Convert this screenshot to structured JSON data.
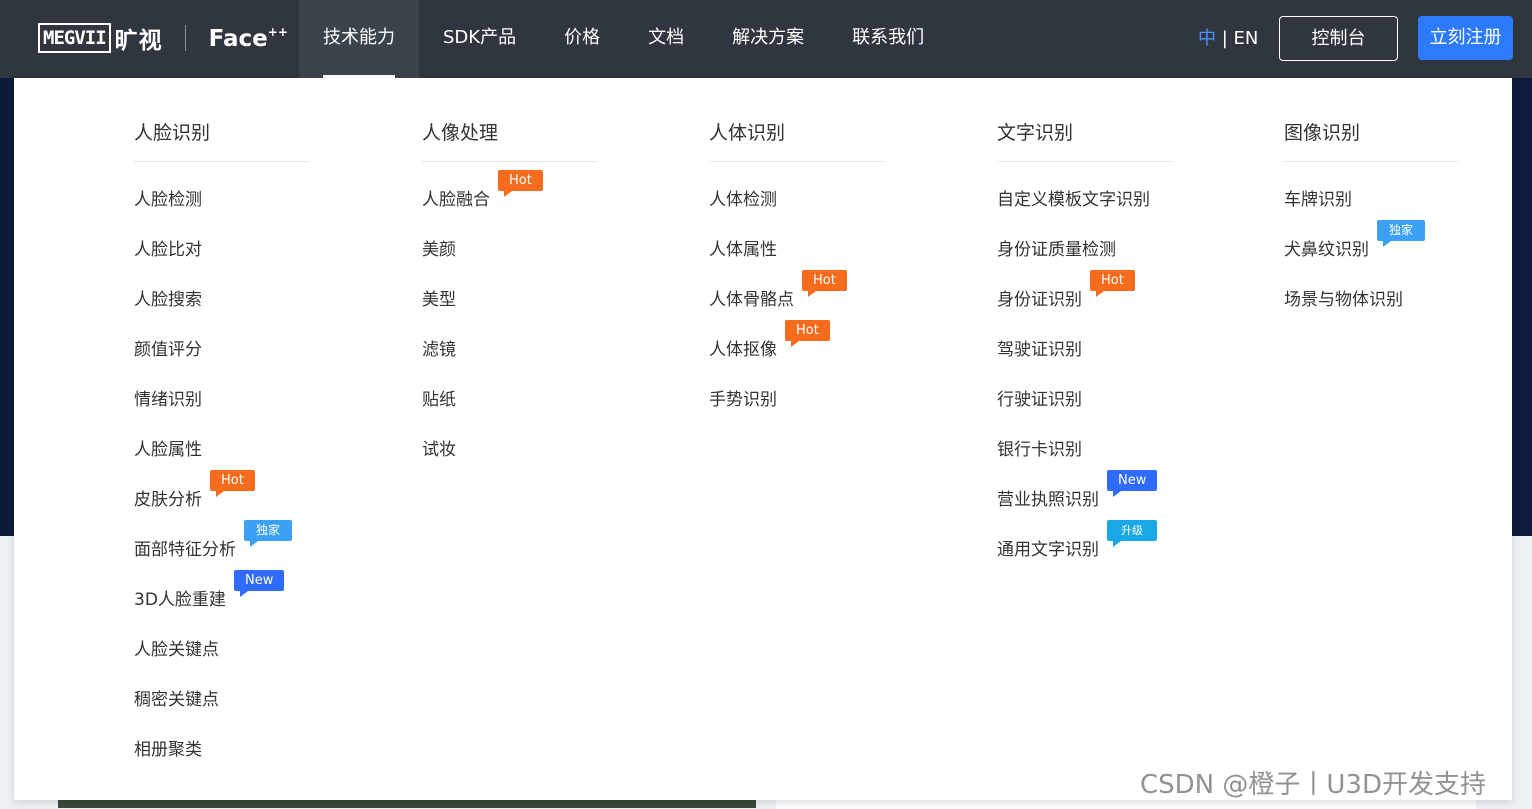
{
  "brand": {
    "megvii": "MEGVII",
    "cn": "旷视",
    "face": "Face",
    "face_sup": "++"
  },
  "nav": {
    "items": [
      {
        "label": "技术能力",
        "active": true
      },
      {
        "label": "SDK产品"
      },
      {
        "label": "价格"
      },
      {
        "label": "文档"
      },
      {
        "label": "解决方案"
      },
      {
        "label": "联系我们"
      }
    ],
    "lang_zh": "中",
    "lang_sep": " | ",
    "lang_en": "EN",
    "console": "控制台",
    "register": "立刻注册"
  },
  "colors": {
    "accent": "#2c7bff",
    "hot": "#f76b1c",
    "new": "#2f6bff",
    "exclusive": "#3ba0f6",
    "upgrade": "#1aa7e5",
    "nav_bg": "#2f363d"
  },
  "columns": [
    {
      "title": "人脸识别",
      "items": [
        {
          "label": "人脸检测"
        },
        {
          "label": "人脸比对"
        },
        {
          "label": "人脸搜索"
        },
        {
          "label": "颜值评分"
        },
        {
          "label": "情绪识别"
        },
        {
          "label": "人脸属性"
        },
        {
          "label": "皮肤分析",
          "badge": "Hot",
          "type": "hot"
        },
        {
          "label": "面部特征分析",
          "badge": "独家",
          "type": "excl"
        },
        {
          "label": "3D人脸重建",
          "badge": "New",
          "type": "new"
        },
        {
          "label": "人脸关键点"
        },
        {
          "label": "稠密关键点"
        },
        {
          "label": "相册聚类"
        }
      ]
    },
    {
      "title": "人像处理",
      "items": [
        {
          "label": "人脸融合",
          "badge": "Hot",
          "type": "hot"
        },
        {
          "label": "美颜"
        },
        {
          "label": "美型"
        },
        {
          "label": "滤镜"
        },
        {
          "label": "贴纸"
        },
        {
          "label": "试妆"
        }
      ]
    },
    {
      "title": "人体识别",
      "items": [
        {
          "label": "人体检测"
        },
        {
          "label": "人体属性"
        },
        {
          "label": "人体骨骼点",
          "badge": "Hot",
          "type": "hot"
        },
        {
          "label": "人体抠像",
          "badge": "Hot",
          "type": "hot"
        },
        {
          "label": "手势识别"
        }
      ]
    },
    {
      "title": "文字识别",
      "items": [
        {
          "label": "自定义模板文字识别"
        },
        {
          "label": "身份证质量检测"
        },
        {
          "label": "身份证识别",
          "badge": "Hot",
          "type": "hot"
        },
        {
          "label": "驾驶证识别"
        },
        {
          "label": "行驶证识别"
        },
        {
          "label": "银行卡识别"
        },
        {
          "label": "营业执照识别",
          "badge": "New",
          "type": "new"
        },
        {
          "label": "通用文字识别",
          "badge": "升级",
          "type": "upgrade"
        }
      ]
    },
    {
      "title": "图像识别",
      "items": [
        {
          "label": "车牌识别"
        },
        {
          "label": "犬鼻纹识别",
          "badge": "独家",
          "type": "excl"
        },
        {
          "label": "场景与物体识别"
        }
      ]
    }
  ],
  "watermark": "CSDN @橙子丨U3D开发支持"
}
